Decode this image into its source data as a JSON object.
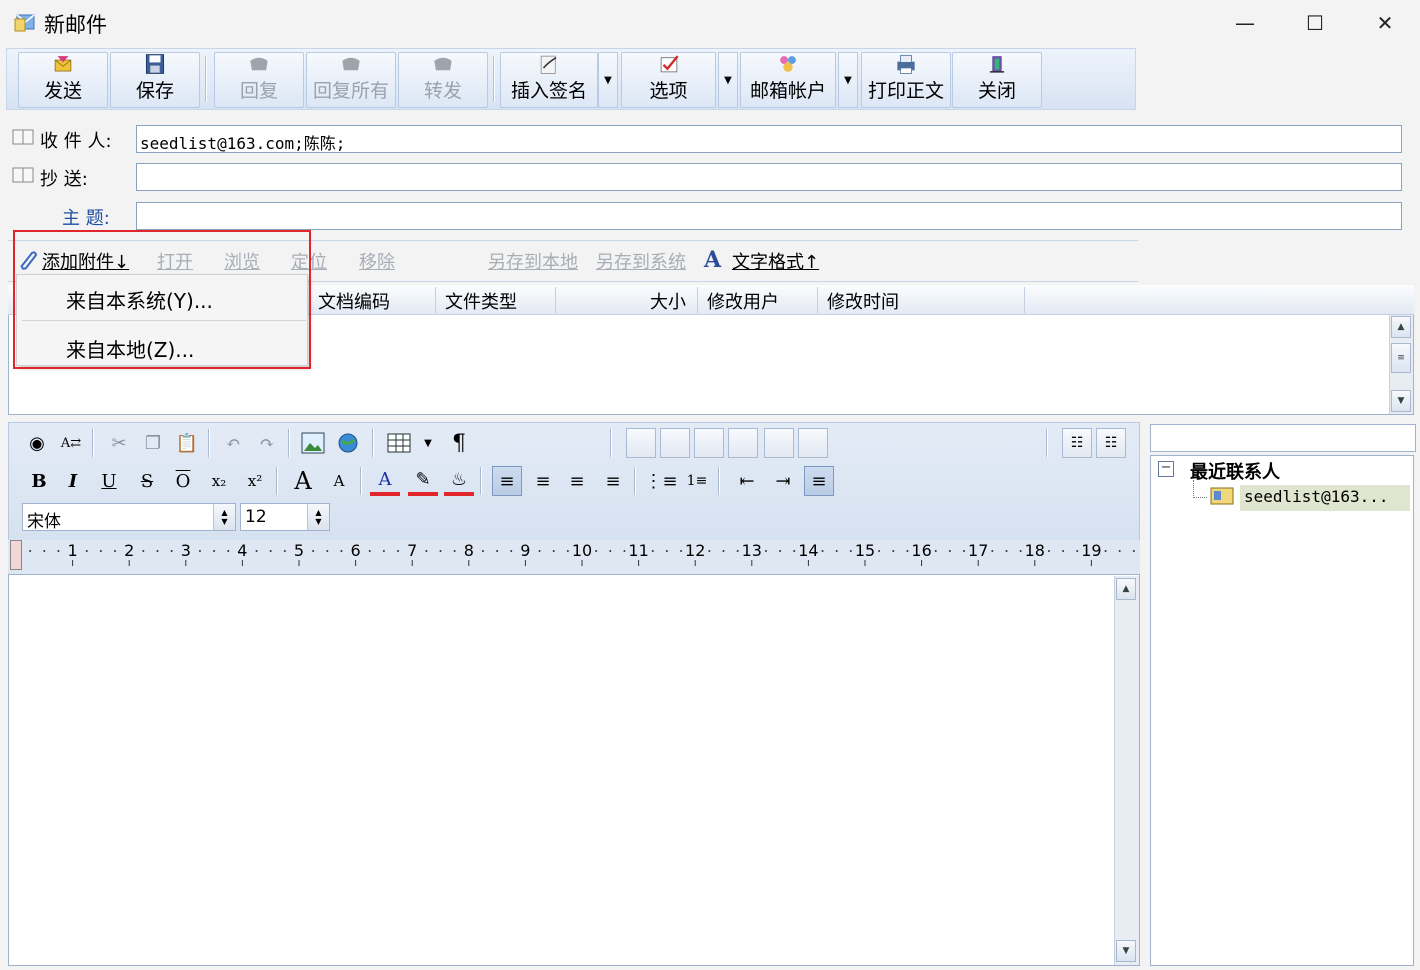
{
  "window": {
    "title": "新邮件"
  },
  "toolbar": {
    "send": "发送",
    "save": "保存",
    "reply": "回复",
    "reply_all": "回复所有",
    "forward": "转发",
    "insert_signature": "插入签名",
    "options": "选项",
    "mail_account": "邮箱帐户",
    "print": "打印正文",
    "close": "关闭"
  },
  "fields": {
    "to_label": "收 件 人:",
    "to_value": "seedlist@163.com;陈陈;",
    "cc_label": "抄   送:",
    "cc_value": "",
    "subject_label": "主  题:",
    "subject_value": ""
  },
  "attachments": {
    "add": "添加附件↓",
    "open": "打开",
    "browse": "浏览",
    "locate": "定位",
    "remove": "移除",
    "save_local": "另存到本地",
    "save_system": "另存到系统",
    "text_format": "文字格式↑",
    "columns": [
      "文档编码",
      "文件类型",
      "大小",
      "修改用户",
      "修改时间"
    ]
  },
  "menu": {
    "from_system": "来自本系统(Y)...",
    "from_local": "来自本地(Z)..."
  },
  "editor": {
    "font": "宋体",
    "size": "12",
    "ruler_numbers": [
      "1",
      "2",
      "3",
      "4",
      "5",
      "6",
      "7",
      "8",
      "9",
      "10",
      "11",
      "12",
      "13",
      "14",
      "15",
      "16",
      "17",
      "18",
      "19"
    ]
  },
  "contacts": {
    "group": "最近联系人",
    "item": "seedlist@163..."
  },
  "colors": {
    "accent": "#e0252b",
    "toolbar": "#dce7f5"
  }
}
